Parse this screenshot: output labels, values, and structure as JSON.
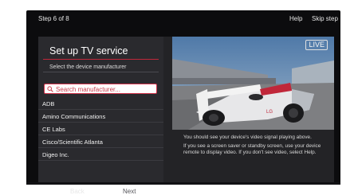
{
  "topbar": {
    "step": "Step 6 of 8",
    "help": "Help",
    "skip": "Skip step"
  },
  "setup": {
    "title": "Set up TV service",
    "subtitle": "Select the device manufacturer",
    "search_placeholder": "Search manufacturer...",
    "manufacturers": [
      "ADB",
      "Amino Communications",
      "CE Labs",
      "Cisco/Scientific Atlanta",
      "Digeo Inc."
    ],
    "back_label": "Back",
    "next_label": "Next"
  },
  "video": {
    "live_badge": "LIVE",
    "car_brand": "LG",
    "message_line1": "You should see your device's video signal playing above.",
    "message_line2": "If you see a screen saver or standby screen, use your device remote to display video. If you don't see video, select Help."
  },
  "colors": {
    "accent": "#c0273a",
    "panel": "#2a2a2e",
    "background": "#0c0c0e"
  }
}
